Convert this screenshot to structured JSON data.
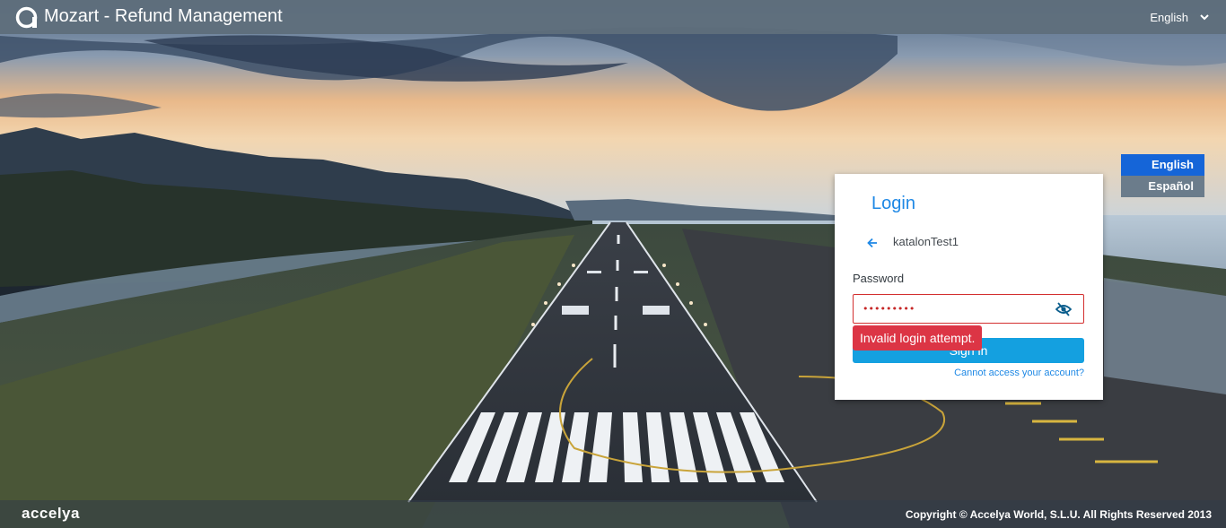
{
  "header": {
    "app_title": "Mozart - Refund Management",
    "language_selected": "English"
  },
  "language_menu": {
    "options": [
      "English",
      "Español"
    ],
    "active": "English"
  },
  "login": {
    "title": "Login",
    "username": "katalonTest1",
    "password_label": "Password",
    "password_value": "•••••••••",
    "signin_label": "Sign in",
    "error_message": "Invalid login attempt.",
    "forgot_link": "Cannot access your account?"
  },
  "footer": {
    "brand": "accelya",
    "copyright": "Copyright © Accelya World, S.L.U. All Rights Reserved 2013"
  },
  "colors": {
    "primary": "#14a0e0",
    "error": "#dc3545",
    "header_bg": "#5f6e7c",
    "active_language": "#1565d8"
  },
  "icons": [
    "logo-icon",
    "chevron-down-icon",
    "back-arrow-icon",
    "eye-slash-icon"
  ]
}
